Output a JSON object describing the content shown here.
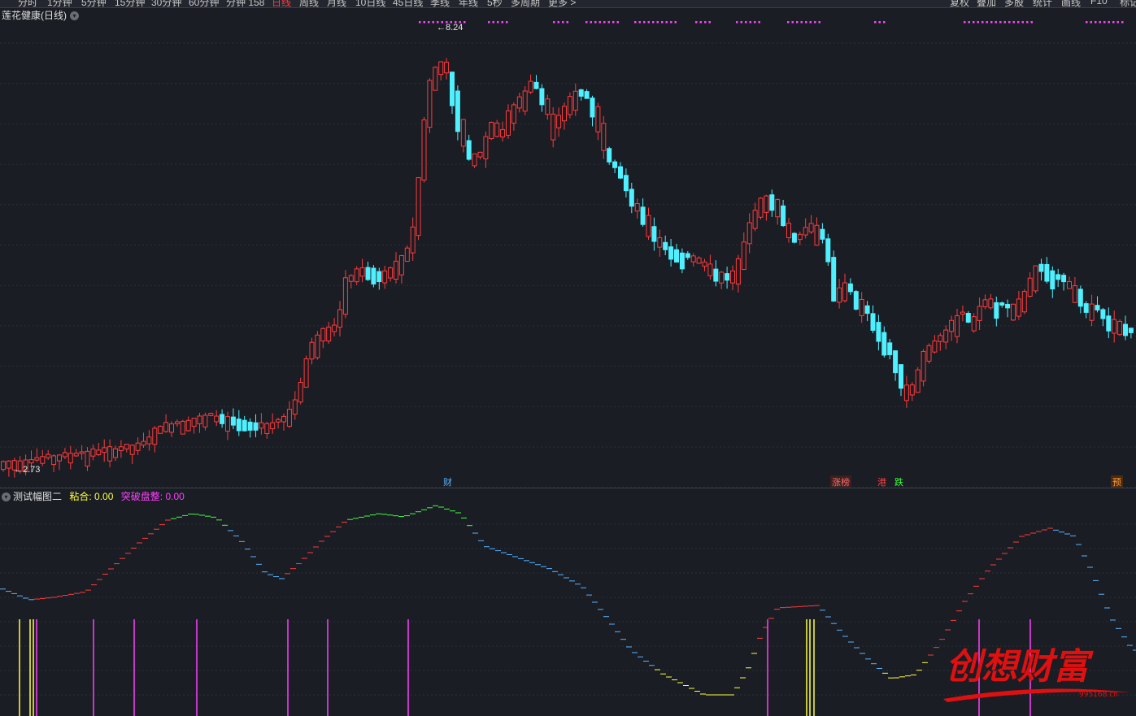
{
  "toolbar": {
    "left_items": [
      "分时",
      "1分钟",
      "5分钟",
      "15分钟",
      "30分钟",
      "60分钟",
      "分钟 158",
      "日线",
      "周线",
      "月线",
      "10日线",
      "45日线",
      "季线",
      "年线",
      "5秒",
      "多周期",
      "更多 >"
    ],
    "active": "日线",
    "right_items": [
      "复权",
      "叠加",
      "多股",
      "统计",
      "画线",
      "F10",
      "标记"
    ]
  },
  "main": {
    "title": "莲花健康(日线)",
    "high_label": "8.24",
    "low_label": "2.73",
    "markers": [
      {
        "text": "财",
        "color": "#5ab4ff"
      },
      {
        "text": "涨榜",
        "color": "#ff6a6a"
      },
      {
        "text": "港",
        "color": "#ff4040"
      },
      {
        "text": "跌",
        "color": "#40ff40"
      },
      {
        "text": "预",
        "color": "#ff9a3c"
      }
    ]
  },
  "indicator": {
    "name": "测试幅图二",
    "label_a": "粘合:",
    "value_a": "0.00",
    "label_b": "突破盘整:",
    "value_b": "0.00"
  },
  "colors": {
    "up": "#ff3b3b",
    "down": "#4ff0ff",
    "grid": "#2b2e36",
    "signal_magenta": "#ff40ff",
    "signal_yellow": "#ffff40",
    "line_green": "#40ff40",
    "line_red": "#ff3b3b",
    "line_blue": "#5ab4ff",
    "line_yellow": "#ffff40"
  },
  "logo": {
    "text": "创想财富",
    "url": "995168.cn"
  }
}
